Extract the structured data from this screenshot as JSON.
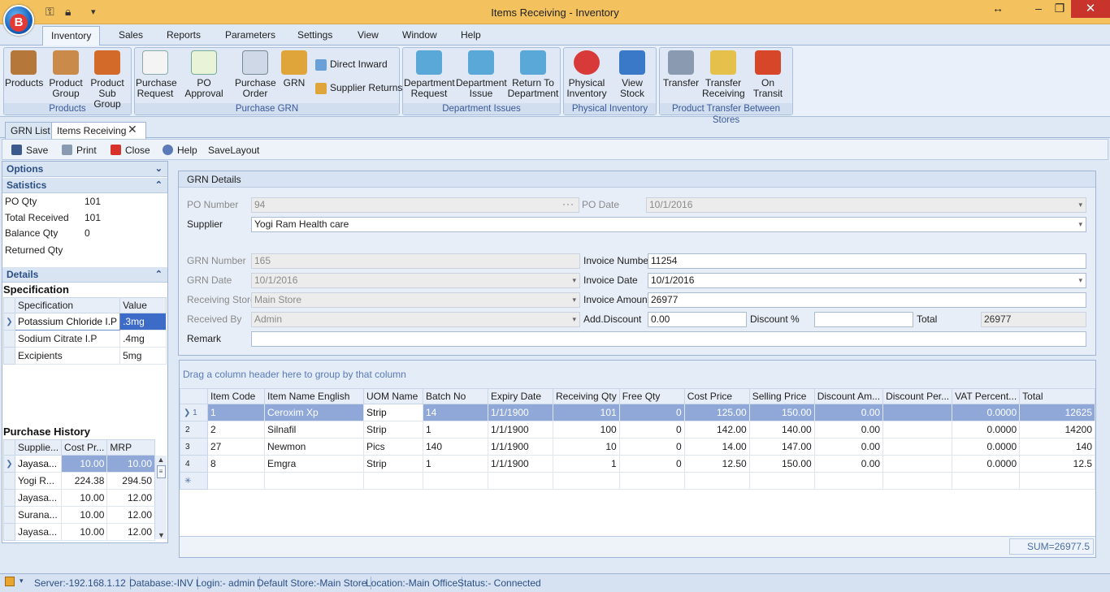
{
  "window": {
    "title": "Items Receiving - Inventory"
  },
  "menu_tabs": [
    "Inventory",
    "Sales",
    "Reports",
    "Parameters",
    "Settings",
    "View",
    "Window",
    "Help"
  ],
  "ribbon": {
    "groups": [
      {
        "label": "Products",
        "buttons": [
          {
            "label": "Products"
          },
          {
            "label": "Product Group"
          },
          {
            "label": "Product Sub Group"
          }
        ]
      },
      {
        "label": "Purchase GRN",
        "buttons": [
          {
            "label": "Purchase Request"
          },
          {
            "label": "PO Approval"
          },
          {
            "label": "Purchase Order"
          },
          {
            "label": "GRN"
          }
        ],
        "small_buttons": [
          {
            "label": "Direct Inward"
          },
          {
            "label": "Supplier Returns"
          }
        ]
      },
      {
        "label": "Department Issues",
        "buttons": [
          {
            "label": "Department Request"
          },
          {
            "label": "Department Issue"
          },
          {
            "label": "Return To Department"
          }
        ]
      },
      {
        "label": "Physical Inventory",
        "buttons": [
          {
            "label": "Physical Inventory"
          },
          {
            "label": "View Stock"
          }
        ]
      },
      {
        "label": "Product Transfer Between Stores",
        "buttons": [
          {
            "label": "Transfer"
          },
          {
            "label": "Transfer Receiving"
          },
          {
            "label": "On Transit"
          }
        ]
      }
    ]
  },
  "doc_tabs": [
    "GRN List",
    "Items Receiving"
  ],
  "toolbar": {
    "save": "Save",
    "print": "Print",
    "close": "Close",
    "help": "Help",
    "savelayout": "SaveLayout"
  },
  "left_panel": {
    "options_title": "Options",
    "statistics_title": "Satistics",
    "stats": [
      {
        "label": "PO Qty",
        "value": "101"
      },
      {
        "label": "Total Received",
        "value": "101"
      },
      {
        "label": "Balance Qty",
        "value": "0"
      },
      {
        "label": "Returned Qty",
        "value": ""
      }
    ],
    "details_title": "Details",
    "specification_title": "Specification",
    "spec_columns": [
      "Specification",
      "Value"
    ],
    "spec_rows": [
      {
        "spec": "Potassium Chloride I.P",
        "value": ".3mg"
      },
      {
        "spec": "Sodium Citrate I.P",
        "value": ".4mg"
      },
      {
        "spec": "Excipients",
        "value": "5mg"
      }
    ],
    "purchase_history_title": "Purchase History",
    "history_columns": [
      "Supplie...",
      "Cost Pr...",
      "MRP"
    ],
    "history_rows": [
      {
        "supplier": "Jayasa...",
        "cost": "10.00",
        "mrp": "10.00"
      },
      {
        "supplier": "Yogi R...",
        "cost": "224.38",
        "mrp": "294.50"
      },
      {
        "supplier": "Jayasa...",
        "cost": "10.00",
        "mrp": "12.00"
      },
      {
        "supplier": "Surana...",
        "cost": "10.00",
        "mrp": "12.00"
      },
      {
        "supplier": "Jayasa...",
        "cost": "10.00",
        "mrp": "12.00"
      }
    ]
  },
  "grn": {
    "title": "GRN Details",
    "po_number_label": "PO Number",
    "po_number": "94",
    "po_date_label": "PO Date",
    "po_date": "10/1/2016",
    "supplier_label": "Supplier",
    "supplier": "Yogi Ram Health care",
    "grn_number_label": "GRN Number",
    "grn_number": "165",
    "grn_date_label": "GRN Date",
    "grn_date": "10/1/2016",
    "store_label": "Receiving Store",
    "store": "Main Store",
    "received_by_label": "Received By",
    "received_by": "Admin",
    "invoice_number_label": "Invoice Number",
    "invoice_number": "11254",
    "invoice_date_label": "Invoice Date",
    "invoice_date": "10/1/2016",
    "invoice_amount_label": "Invoice Amount",
    "invoice_amount": "26977",
    "add_discount_label": "Add.Discount",
    "add_discount": "0.00",
    "discount_pct_label": "Discount %",
    "discount_pct": "",
    "total_label": "Total",
    "total": "26977",
    "remark_label": "Remark",
    "remark": ""
  },
  "items_grid": {
    "group_hint": "Drag a column header here to group by that column",
    "columns": [
      "Item Code",
      "Item Name English",
      "UOM Name",
      "Batch No",
      "Expiry Date",
      "Receiving Qty",
      "Free Qty",
      "Cost Price",
      "Selling Price",
      "Discount Am...",
      "Discount Per...",
      "VAT Percent...",
      "Total"
    ],
    "rows": [
      {
        "n": "1",
        "code": "1",
        "name": "Ceroxim Xp",
        "uom": "Strip",
        "batch": "14",
        "expiry": "1/1/1900",
        "qty": "101",
        "free": "0",
        "cost": "125.00",
        "sell": "150.00",
        "disc_amt": "0.00",
        "disc_per": "",
        "vat": "0.0000",
        "total": "12625"
      },
      {
        "n": "2",
        "code": "2",
        "name": "Silnafil",
        "uom": "Strip",
        "batch": "1",
        "expiry": "1/1/1900",
        "qty": "100",
        "free": "0",
        "cost": "142.00",
        "sell": "140.00",
        "disc_amt": "0.00",
        "disc_per": "",
        "vat": "0.0000",
        "total": "14200"
      },
      {
        "n": "3",
        "code": "27",
        "name": "Newmon",
        "uom": "Pics",
        "batch": "140",
        "expiry": "1/1/1900",
        "qty": "10",
        "free": "0",
        "cost": "14.00",
        "sell": "147.00",
        "disc_amt": "0.00",
        "disc_per": "",
        "vat": "0.0000",
        "total": "140"
      },
      {
        "n": "4",
        "code": "8",
        "name": "Emgra",
        "uom": "Strip",
        "batch": "1",
        "expiry": "1/1/1900",
        "qty": "1",
        "free": "0",
        "cost": "12.50",
        "sell": "150.00",
        "disc_amt": "0.00",
        "disc_per": "",
        "vat": "0.0000",
        "total": "12.5"
      }
    ],
    "sum": "SUM=26977.5"
  },
  "statusbar": {
    "server": "Server:-192.168.1.12",
    "database": "Database:-INV",
    "login": "Login:- admin",
    "store": "Default Store:-Main Store",
    "location": "Location:-Main Office",
    "status": "Status:- Connected"
  },
  "icons": {
    "orb": "app-logo-b",
    "colors": {
      "titlebar": "#f3c25e",
      "accent": "#2b4f84",
      "selection": "#8fa8d8",
      "close": "#c8342c"
    }
  }
}
